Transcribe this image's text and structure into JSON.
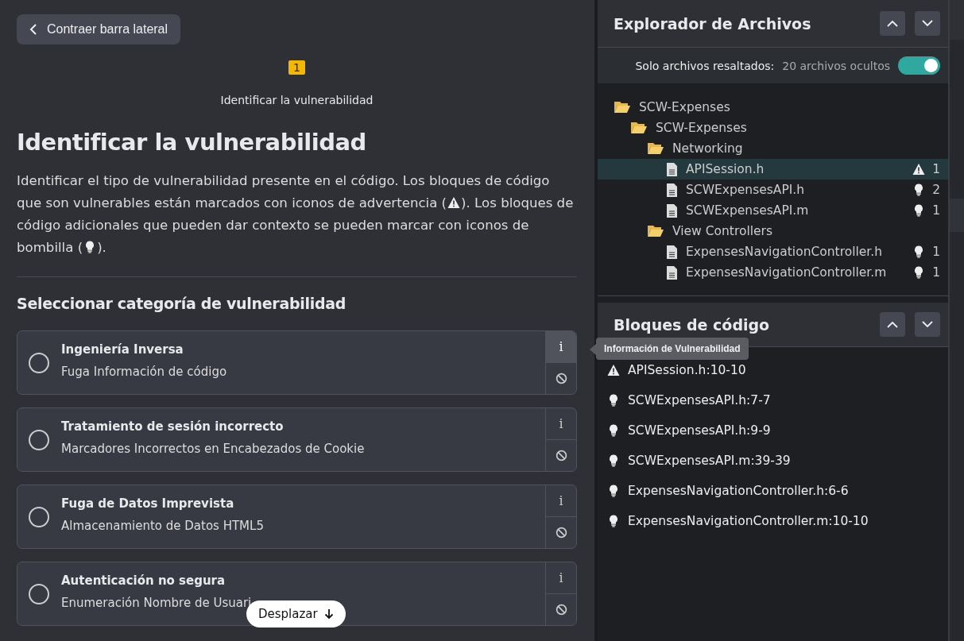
{
  "collapse_button": "Contraer barra lateral",
  "step": {
    "number": "1",
    "label": "Identificar la vulnerabilidad"
  },
  "heading": "Identificar la vulnerabilidad",
  "description": [
    {
      "kind": "text",
      "text": "Identificar el tipo de vulnerabilidad presente en el código. Los bloques de código que son vulnerables están marcados con iconos de advertencia ("
    },
    {
      "kind": "warning"
    },
    {
      "kind": "text",
      "text": "). Los bloques de código adicionales que pueden dar contexto se pueden marcar con iconos de bombilla ("
    },
    {
      "kind": "bulb"
    },
    {
      "kind": "text",
      "text": ")."
    }
  ],
  "section_heading": "Seleccionar categoría de vulnerabilidad",
  "categories": [
    {
      "title": "Ingeniería Inversa",
      "subtitle": "Fuga Información de código",
      "selected": false,
      "info_button": "i",
      "info_hovered": true,
      "tooltip": "Información de Vulnerabilidad"
    },
    {
      "title": "Tratamiento de sesión incorrecto",
      "subtitle": "Marcadores Incorrectos en Encabezados de Cookie",
      "selected": false,
      "info_button": "i",
      "info_hovered": false
    },
    {
      "title": "Fuga de Datos Imprevista",
      "subtitle": "Almacenamiento de Datos HTML5",
      "selected": false,
      "info_button": "i",
      "info_hovered": false
    },
    {
      "title": "Autenticación no segura",
      "subtitle": "Enumeración Nombre de Usuari",
      "selected": false,
      "info_button": "i",
      "info_hovered": false
    }
  ],
  "scroll_button": "Desplazar",
  "file_explorer": {
    "title": "Explorador de Archivos",
    "filter_label": "Solo archivos resaltados:",
    "filter_count": "20 archivos ocultos",
    "filter_on": true,
    "tree": [
      {
        "kind": "folder",
        "name": "SCW-Expenses",
        "children": [
          {
            "kind": "folder",
            "name": "SCW-Expenses",
            "children": [
              {
                "kind": "folder",
                "name": "Networking",
                "children": [
                  {
                    "kind": "file",
                    "name": "APISession.h",
                    "selected": true,
                    "badge": {
                      "kind": "warning",
                      "count": "1"
                    }
                  },
                  {
                    "kind": "file",
                    "name": "SCWExpensesAPI.h",
                    "selected": false,
                    "badge": {
                      "kind": "bulb",
                      "count": "2"
                    }
                  },
                  {
                    "kind": "file",
                    "name": "SCWExpensesAPI.m",
                    "selected": false,
                    "badge": {
                      "kind": "bulb",
                      "count": "1"
                    }
                  }
                ]
              },
              {
                "kind": "folder",
                "name": "View Controllers",
                "children": [
                  {
                    "kind": "file",
                    "name": "ExpensesNavigationController.h",
                    "selected": false,
                    "badge": {
                      "kind": "bulb",
                      "count": "1"
                    }
                  },
                  {
                    "kind": "file",
                    "name": "ExpensesNavigationController.m",
                    "selected": false,
                    "badge": {
                      "kind": "bulb",
                      "count": "1"
                    }
                  }
                ]
              }
            ]
          }
        ]
      }
    ]
  },
  "code_blocks": {
    "title": "Bloques de código",
    "items": [
      {
        "kind": "warning",
        "label": "APISession.h:10-10"
      },
      {
        "kind": "bulb",
        "label": "SCWExpensesAPI.h:7-7"
      },
      {
        "kind": "bulb",
        "label": "SCWExpensesAPI.h:9-9"
      },
      {
        "kind": "bulb",
        "label": "SCWExpensesAPI.m:39-39"
      },
      {
        "kind": "bulb",
        "label": "ExpensesNavigationController.h:6-6"
      },
      {
        "kind": "bulb",
        "label": "ExpensesNavigationController.m:10-10"
      }
    ]
  }
}
